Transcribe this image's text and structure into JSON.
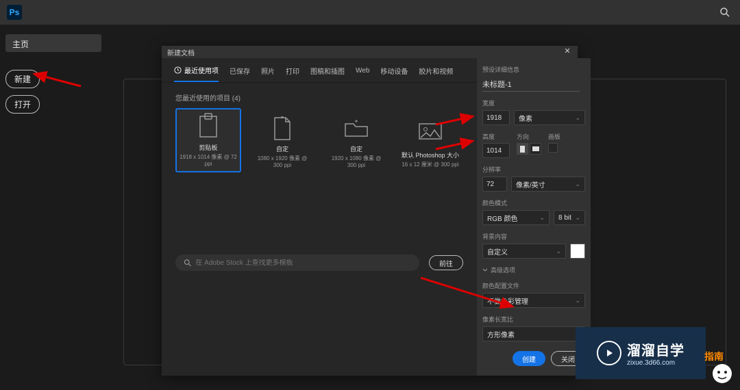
{
  "topbar": {
    "logo": "Ps"
  },
  "sidebar": {
    "home": "主页",
    "new": "新建",
    "open": "打开"
  },
  "dialog": {
    "title": "新建文档",
    "tabs": {
      "recent": "最近使用项",
      "saved": "已保存",
      "photo": "照片",
      "print": "打印",
      "art": "图稿和插图",
      "web": "Web",
      "mobile": "移动设备",
      "film": "胶片和视频"
    },
    "recent_label": "您最近使用的项目 (4)",
    "presets": [
      {
        "name": "剪贴板",
        "sub": "1918 x 1014 像素 @ 72 ppi"
      },
      {
        "name": "自定",
        "sub": "1080 x 1920 像素 @ 300 ppi"
      },
      {
        "name": "自定",
        "sub": "1920 x 1080 像素 @ 300 ppi"
      },
      {
        "name": "默认 Photoshop 大小",
        "sub": "16 x 12 厘米 @ 300 ppi"
      }
    ],
    "stock": {
      "placeholder": "在 Adobe Stock 上查找更多模板",
      "go": "前往"
    },
    "right": {
      "section": "预设详细信息",
      "name": "未标题-1",
      "width_label": "宽度",
      "width": "1918",
      "width_unit": "像素",
      "height_label": "高度",
      "height": "1014",
      "orient_label": "方向",
      "artboard_label": "画板",
      "res_label": "分辨率",
      "res": "72",
      "res_unit": "像素/英寸",
      "mode_label": "颜色模式",
      "mode": "RGB 颜色",
      "depth": "8 bit",
      "bg_label": "背景内容",
      "bg": "自定义",
      "advanced": "高级选项",
      "profile_label": "颜色配置文件",
      "profile": "不做色彩管理",
      "aspect_label": "像素长宽比",
      "aspect": "方形像素",
      "create": "创建",
      "close": "关闭"
    }
  },
  "watermark": {
    "cn": "溜溜自学",
    "en": "zixue.3d66.com",
    "badge": "指南"
  }
}
